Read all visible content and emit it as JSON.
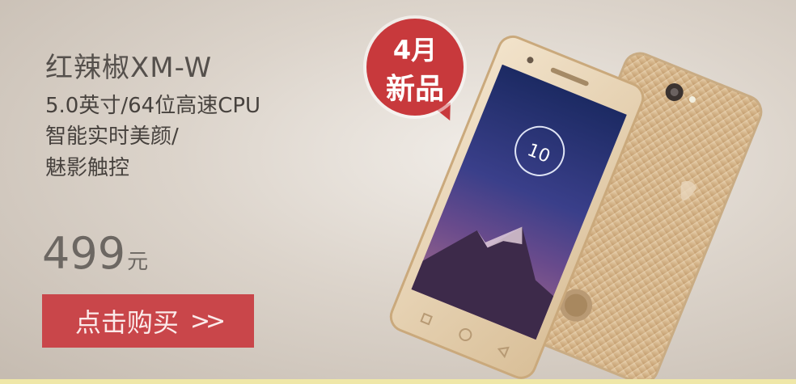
{
  "banner": {
    "title": "红辣椒XM-W",
    "features": [
      "5.0英寸/64位高速CPU",
      "智能实时美颜/",
      "魅影触控"
    ],
    "price_value": "499",
    "price_unit": "元",
    "buy_label": "点击购买",
    "buy_arrow": ">>",
    "badge_line1": "4月",
    "badge_line2": "新品",
    "clock_time": "10"
  },
  "colors": {
    "accent_red": "#c9464a",
    "badge_red": "#c8393c",
    "gold": "#d8b98f"
  }
}
